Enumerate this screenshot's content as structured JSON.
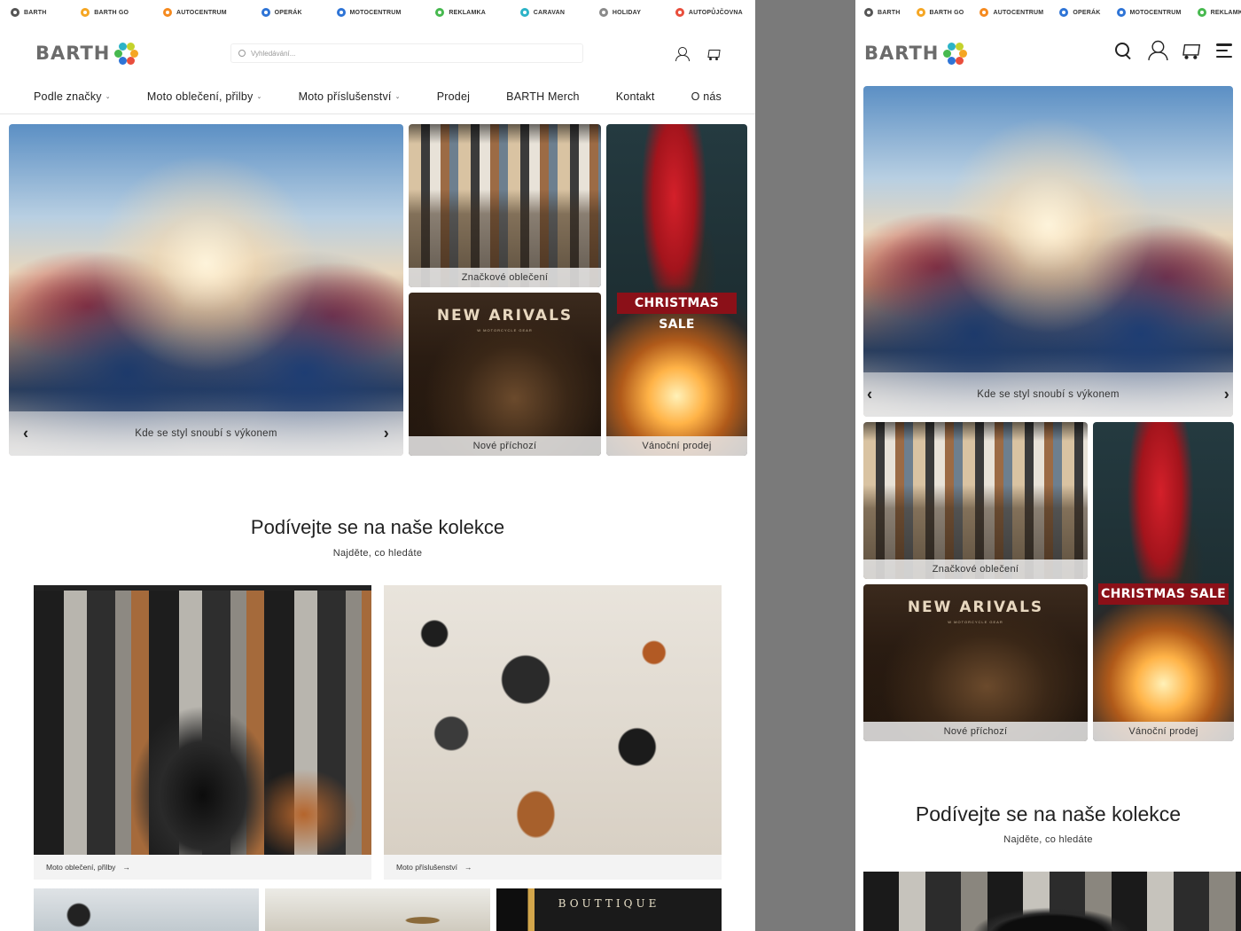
{
  "brand_bar": [
    {
      "label": "BARTH",
      "color": "#555555"
    },
    {
      "label": "BARTH GO",
      "color": "#f5a623"
    },
    {
      "label": "AUTOCENTRUM",
      "color": "#f58a1f"
    },
    {
      "label": "OPERÁK",
      "color": "#2e74d6"
    },
    {
      "label": "MOTOCENTRUM",
      "color": "#2e74d6"
    },
    {
      "label": "REKLAMKA",
      "color": "#47b94f"
    },
    {
      "label": "CARAVAN",
      "color": "#2cb3c7"
    },
    {
      "label": "HOLIDAY",
      "color": "#8a8a8a"
    },
    {
      "label": "AUTOPŮJČOVNA",
      "color": "#e94e3c"
    }
  ],
  "mobile_brand_bar": [
    {
      "label": "BARTH",
      "color": "#555555"
    },
    {
      "label": "BARTH GO",
      "color": "#f5a623"
    },
    {
      "label": "AUTOCENTRUM",
      "color": "#f58a1f"
    },
    {
      "label": "OPERÁK",
      "color": "#2e74d6"
    },
    {
      "label": "MOTOCENTRUM",
      "color": "#2e74d6"
    },
    {
      "label": "REKLAMKA",
      "color": "#47b94f"
    }
  ],
  "logo": {
    "text": "BARTH"
  },
  "search": {
    "placeholder": "Vyhledávání..."
  },
  "nav": [
    {
      "label": "Podle značky",
      "dropdown": true
    },
    {
      "label": "Moto oblečení, přilby",
      "dropdown": true
    },
    {
      "label": "Moto příslušenství",
      "dropdown": true
    },
    {
      "label": "Prodej",
      "dropdown": false
    },
    {
      "label": "BARTH Merch",
      "dropdown": false
    },
    {
      "label": "Kontakt",
      "dropdown": false
    },
    {
      "label": "O nás",
      "dropdown": false
    }
  ],
  "hero": {
    "caption": "Kde se styl snoubí s výkonem",
    "prev": "‹",
    "next": "›"
  },
  "tiles": {
    "clothes": {
      "caption": "Značkové oblečení"
    },
    "arrivals": {
      "caption": "Nové příchozí",
      "title": "NEW ARIVALS",
      "subtitle": "W MOTORCYCLE GEAR"
    },
    "xmas": {
      "caption": "Vánoční prodej",
      "banner": "CHRISTMAS SALE"
    }
  },
  "collections": {
    "title": "Podívejte se na naše kolekce",
    "subtitle": "Najděte, co hledáte",
    "cards": [
      {
        "label": "Moto oblečení, přilby",
        "arrow": "→"
      },
      {
        "label": "Moto příslušenství",
        "arrow": "→"
      }
    ],
    "boutique_text": "BOUTTIQUE"
  },
  "colors": {
    "accent_red": "#8b1018",
    "text": "#222222",
    "caption_bg": "#ebebeb"
  }
}
